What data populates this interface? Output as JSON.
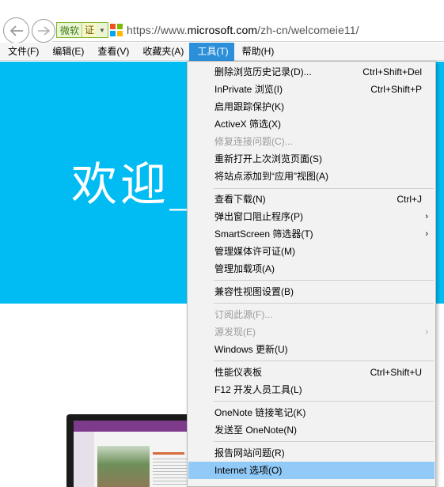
{
  "address_bar": {
    "cert_org": "微软",
    "cert_badge": "证",
    "url_scheme": "https://www.",
    "url_domain": "microsoft.com",
    "url_path": "/zh-cn/welcomeie11/"
  },
  "menubar": {
    "items": [
      {
        "label": "文件(F)"
      },
      {
        "label": "编辑(E)"
      },
      {
        "label": "查看(V)"
      },
      {
        "label": "收藏夹(A)"
      },
      {
        "label": "工具(T)",
        "active": true
      },
      {
        "label": "帮助(H)"
      }
    ]
  },
  "page": {
    "welcome_text": "欢迎_",
    "banner_color": "#00bcf2"
  },
  "tools_menu": {
    "items": [
      {
        "label": "删除浏览历史记录(D)...",
        "shortcut": "Ctrl+Shift+Del"
      },
      {
        "label": "InPrivate 浏览(I)",
        "shortcut": "Ctrl+Shift+P"
      },
      {
        "label": "启用跟踪保护(K)"
      },
      {
        "label": "ActiveX 筛选(X)"
      },
      {
        "label": "修复连接问题(C)...",
        "disabled": true
      },
      {
        "label": "重新打开上次浏览页面(S)"
      },
      {
        "label": "将站点添加到“应用”视图(A)"
      },
      {
        "label": "查看下载(N)",
        "shortcut": "Ctrl+J"
      },
      {
        "label": "弹出窗口阻止程序(P)",
        "submenu": true
      },
      {
        "label": "SmartScreen 筛选器(T)",
        "submenu": true
      },
      {
        "label": "管理媒体许可证(M)"
      },
      {
        "label": "管理加载项(A)"
      },
      {
        "label": "兼容性视图设置(B)"
      },
      {
        "label": "订阅此源(F)...",
        "disabled": true
      },
      {
        "label": "源发现(E)",
        "disabled": true,
        "submenu": true
      },
      {
        "label": "Windows 更新(U)"
      },
      {
        "label": "性能仪表板",
        "shortcut": "Ctrl+Shift+U"
      },
      {
        "label": "F12 开发人员工具(L)"
      },
      {
        "label": "OneNote 链接笔记(K)"
      },
      {
        "label": "发送至 OneNote(N)"
      },
      {
        "label": "报告网站问题(R)"
      },
      {
        "label": "Internet 选项(O)",
        "highlighted": true
      }
    ],
    "highlight_color": "#91c9f7"
  },
  "colors": {
    "menubar_active": "#2c8fd9",
    "ms_logo": [
      "#f25022",
      "#7fba00",
      "#00a4ef",
      "#ffb900"
    ]
  }
}
